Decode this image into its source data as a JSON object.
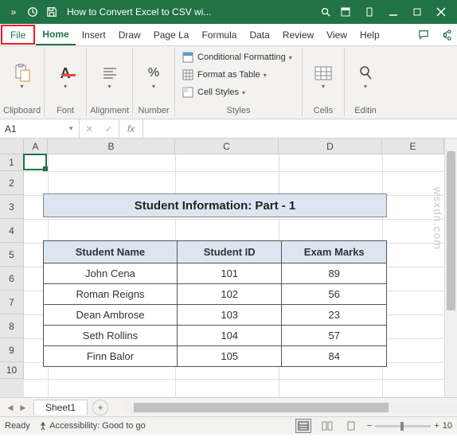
{
  "titlebar": {
    "title": "How to Convert Excel to CSV wi..."
  },
  "tabs": {
    "file": "File",
    "home": "Home",
    "insert": "Insert",
    "draw": "Draw",
    "pagelayout": "Page La",
    "formulas": "Formula",
    "data": "Data",
    "review": "Review",
    "view": "View",
    "help": "Help"
  },
  "ribbon": {
    "clipboard": "Clipboard",
    "font": "Font",
    "alignment": "Alignment",
    "number": "Number",
    "styles": "Styles",
    "cells": "Cells",
    "editing": "Editin",
    "cond_format": "Conditional Formatting",
    "format_table": "Format as Table",
    "cell_styles": "Cell Styles"
  },
  "namebox": {
    "ref": "A1"
  },
  "watermark": "wsxdn.com",
  "sheet": {
    "title": "Student Information: Part - 1",
    "headers": [
      "Student Name",
      "Student ID",
      "Exam Marks"
    ],
    "rows": [
      {
        "name": "John Cena",
        "id": "101",
        "marks": "89"
      },
      {
        "name": "Roman Reigns",
        "id": "102",
        "marks": "56"
      },
      {
        "name": "Dean Ambrose",
        "id": "103",
        "marks": "23"
      },
      {
        "name": "Seth Rollins",
        "id": "104",
        "marks": "57"
      },
      {
        "name": "Finn Balor",
        "id": "105",
        "marks": "84"
      }
    ]
  },
  "cols": [
    "A",
    "B",
    "C",
    "D",
    "E"
  ],
  "rownums": [
    "1",
    "2",
    "3",
    "4",
    "5",
    "6",
    "7",
    "8",
    "9",
    "10"
  ],
  "sheettab": {
    "name": "Sheet1"
  },
  "status": {
    "ready": "Ready",
    "accessibility": "Accessibility: Good to go",
    "zoom": "10"
  }
}
